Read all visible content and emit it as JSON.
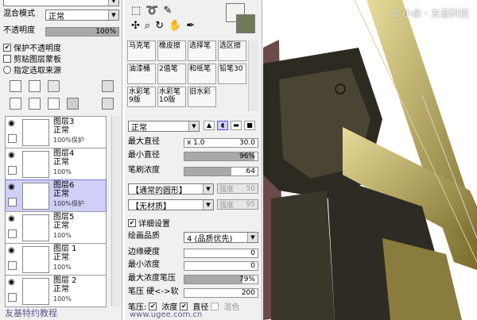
{
  "left": {
    "top_combo": "",
    "blend_label": "混合模式",
    "blend_value": "正常",
    "opacity_label": "不透明度",
    "opacity_value": "100%",
    "opacity_fraction": 1.0,
    "protect_opacity": "保护不透明度",
    "clip_group": "剪贴图层蒙板",
    "selection_source": "指定选取来源",
    "layers": [
      {
        "name": "图层3",
        "mode": "正常",
        "opacity": "100%保护",
        "selected": false
      },
      {
        "name": "图层4",
        "mode": "正常",
        "opacity": "100%",
        "selected": false
      },
      {
        "name": "图层6",
        "mode": "正常",
        "opacity": "100%保护",
        "selected": true
      },
      {
        "name": "图层5",
        "mode": "正常",
        "opacity": "100%",
        "selected": false
      },
      {
        "name": "图层 1",
        "mode": "正常",
        "opacity": "100%",
        "selected": false
      },
      {
        "name": "图层 2",
        "mode": "正常",
        "opacity": "100%",
        "selected": false
      }
    ],
    "footer": "友基特约教程"
  },
  "mid": {
    "tools": [
      "马克笔",
      "橡皮擦",
      "选择笔",
      "选区擦",
      "油漆桶",
      "2值笔",
      "和纸笔",
      "铅笔30",
      "水彩笔9版",
      "水彩笔10版",
      "旧水彩"
    ],
    "mode_value": "正常",
    "max_diameter_label": "最大直径",
    "max_diameter_mult": "x 1.0",
    "max_diameter_value": "30.0",
    "min_diameter_label": "最小直径",
    "min_diameter_value": "96%",
    "min_diameter_fraction": 0.96,
    "brush_density_label": "笔刷浓度",
    "brush_density_value": "64",
    "brush_density_fraction": 0.64,
    "shape_value": "【通常的圆形】",
    "texture_value": "【无材质】",
    "strength_label": "强度",
    "strength1": "50",
    "strength2": "95",
    "detail_settings": "详细设置",
    "quality_label": "绘画品质",
    "quality_value": "4 (品质优先)",
    "edge_hardness_label": "边缘硬度",
    "edge_hardness_value": "0",
    "min_density_label": "最小浓度",
    "min_density_value": "0",
    "max_density_pressure_label": "最大浓度笔压",
    "max_density_pressure_value": "79%",
    "max_density_pressure_fraction": 0.79,
    "pressure_label": "笔压 硬<->软",
    "pressure_value": "200",
    "pressure_row_label": "笔压:",
    "density_check": "浓度",
    "diameter_check": "直径",
    "blend_check": "混色",
    "footer": "www.ugee.com.cn"
  },
  "watermark": "© 小余・友基科技",
  "colors": {
    "selection": "#cfcff7",
    "fg_color": "#f2f2ee",
    "bg_color": "#6e7a5a"
  }
}
